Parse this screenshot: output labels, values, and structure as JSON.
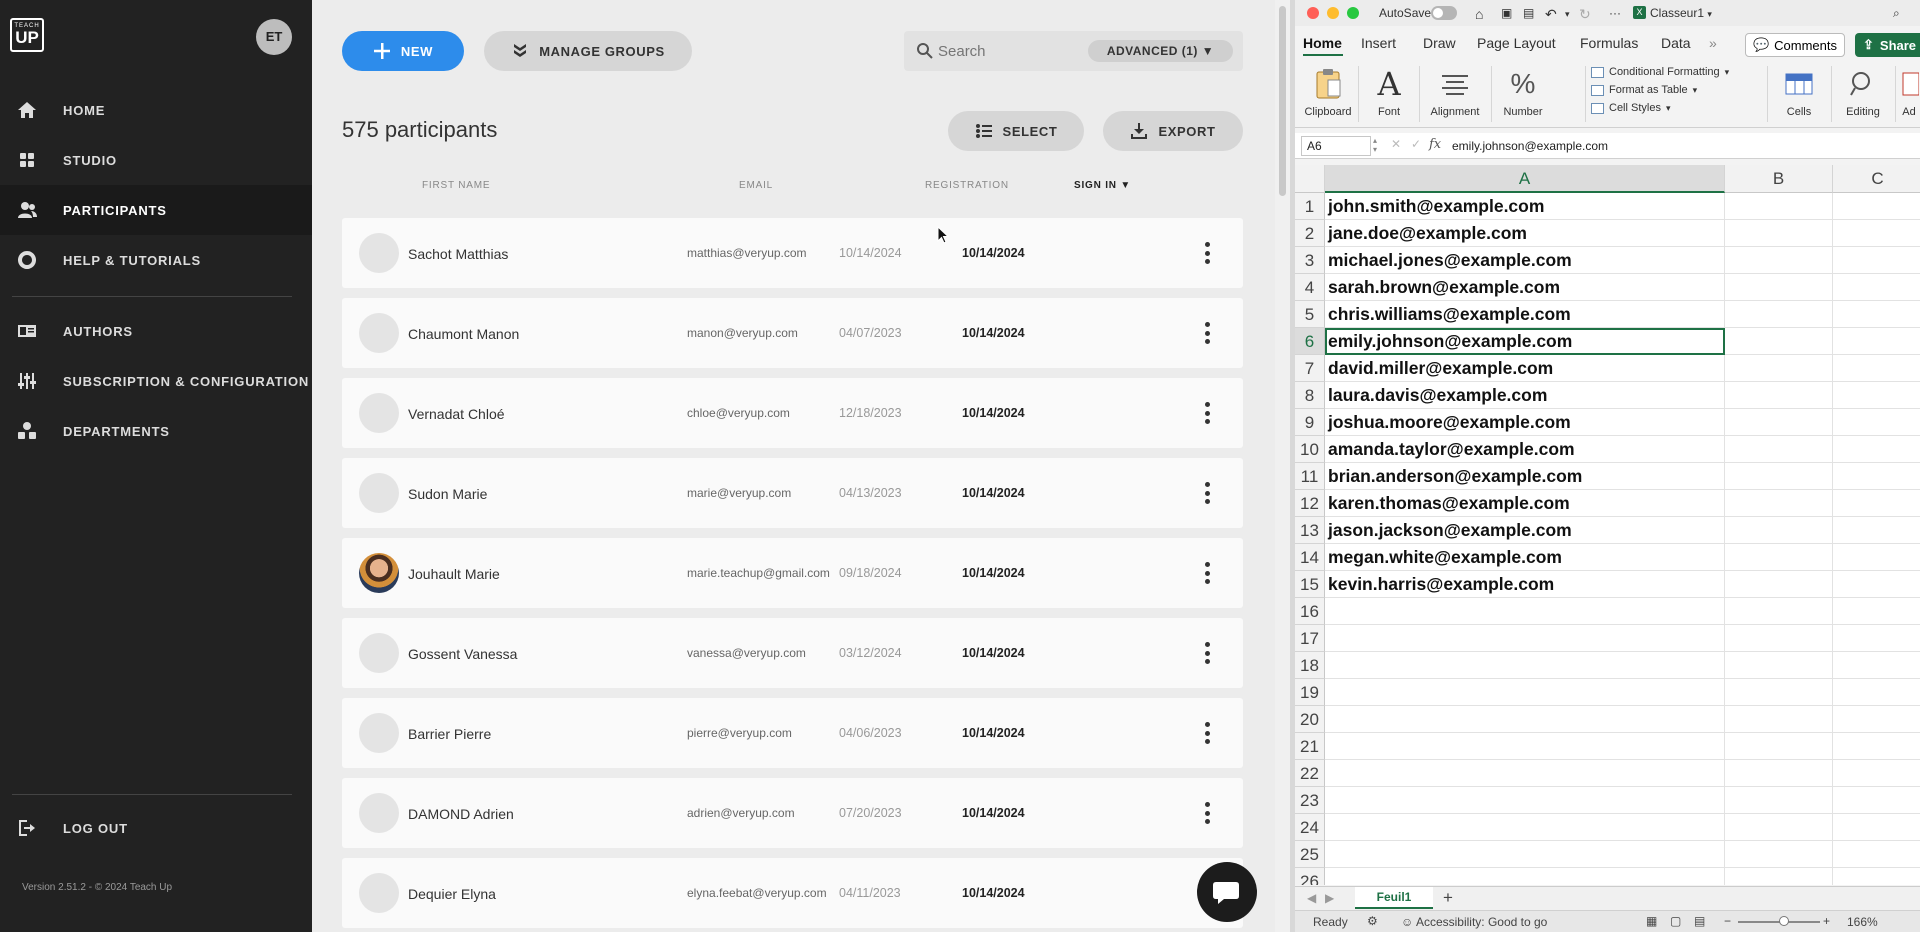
{
  "sidebar": {
    "logo": {
      "line1": "TEACH",
      "line2": "UP"
    },
    "avatar_initials": "ET",
    "items": [
      {
        "label": "HOME",
        "icon": "home-icon"
      },
      {
        "label": "STUDIO",
        "icon": "grid-icon"
      },
      {
        "label": "PARTICIPANTS",
        "icon": "users-icon",
        "active": true
      },
      {
        "label": "HELP & TUTORIALS",
        "icon": "lifebuoy-icon"
      },
      {
        "label": "AUTHORS",
        "icon": "id-card-icon"
      },
      {
        "label": "SUBSCRIPTION & CONFIGURATION",
        "icon": "sliders-icon"
      },
      {
        "label": "DEPARTMENTS",
        "icon": "org-icon"
      }
    ],
    "logout_label": "LOG OUT",
    "version": "Version 2.51.2 - © 2024 Teach Up"
  },
  "toolbar": {
    "new_label": "NEW",
    "manage_groups_label": "MANAGE GROUPS",
    "search_placeholder": "Search",
    "advanced_label": "ADVANCED (1)",
    "select_label": "SELECT",
    "export_label": "EXPORT"
  },
  "participants": {
    "count_label": "575 participants",
    "columns": {
      "first_name": "FIRST NAME",
      "email": "EMAIL",
      "registration": "REGISTRATION",
      "sign_in": "SIGN IN"
    },
    "rows": [
      {
        "name": "Sachot Matthias",
        "email": "matthias@veryup.com",
        "registration": "10/14/2024",
        "sign_in": "10/14/2024",
        "photo": false
      },
      {
        "name": "Chaumont Manon",
        "email": "manon@veryup.com",
        "registration": "04/07/2023",
        "sign_in": "10/14/2024",
        "photo": false
      },
      {
        "name": "Vernadat Chloé",
        "email": "chloe@veryup.com",
        "registration": "12/18/2023",
        "sign_in": "10/14/2024",
        "photo": false
      },
      {
        "name": "Sudon Marie",
        "email": "marie@veryup.com",
        "registration": "04/13/2023",
        "sign_in": "10/14/2024",
        "photo": false
      },
      {
        "name": "Jouhault Marie",
        "email": "marie.teachup@gmail.com",
        "registration": "09/18/2024",
        "sign_in": "10/14/2024",
        "photo": true
      },
      {
        "name": "Gossent Vanessa",
        "email": "vanessa@veryup.com",
        "registration": "03/12/2024",
        "sign_in": "10/14/2024",
        "photo": false
      },
      {
        "name": "Barrier Pierre",
        "email": "pierre@veryup.com",
        "registration": "04/06/2023",
        "sign_in": "10/14/2024",
        "photo": false
      },
      {
        "name": "DAMOND Adrien",
        "email": "adrien@veryup.com",
        "registration": "07/20/2023",
        "sign_in": "10/14/2024",
        "photo": false
      },
      {
        "name": "Dequier Elyna",
        "email": "elyna.feebat@veryup.com",
        "registration": "04/11/2023",
        "sign_in": "10/14/2024",
        "photo": false
      }
    ]
  },
  "excel": {
    "autosave_label": "AutoSave",
    "workbook_name": "Classeur1",
    "tabs": [
      "Home",
      "Insert",
      "Draw",
      "Page Layout",
      "Formulas",
      "Data"
    ],
    "overflow_tabs": "»",
    "comments_label": "Comments",
    "share_label": "Share",
    "ribbon": {
      "clipboard": "Clipboard",
      "font": "Font",
      "alignment": "Alignment",
      "number": "Number",
      "conditional_formatting": "Conditional Formatting",
      "format_as_table": "Format as Table",
      "cell_styles": "Cell Styles",
      "cells": "Cells",
      "editing": "Editing",
      "addins": "Ad"
    },
    "name_box": "A6",
    "fx_label": "fx",
    "formula_value": "emily.johnson@example.com",
    "columns": [
      "A",
      "B",
      "C"
    ],
    "active_row": 6,
    "row_numbers": [
      "1",
      "2",
      "3",
      "4",
      "5",
      "6",
      "7",
      "8",
      "9",
      "10",
      "11",
      "12",
      "13",
      "14",
      "15",
      "16",
      "17",
      "18",
      "19",
      "20",
      "21",
      "22",
      "23",
      "24",
      "25",
      "26"
    ],
    "cells_A": [
      "john.smith@example.com",
      "jane.doe@example.com",
      "michael.jones@example.com",
      "sarah.brown@example.com",
      "chris.williams@example.com",
      "emily.johnson@example.com",
      "david.miller@example.com",
      "laura.davis@example.com",
      "joshua.moore@example.com",
      "amanda.taylor@example.com",
      "brian.anderson@example.com",
      "karen.thomas@example.com",
      "jason.jackson@example.com",
      "megan.white@example.com",
      "kevin.harris@example.com",
      "",
      "",
      "",
      "",
      "",
      "",
      "",
      "",
      "",
      "",
      ""
    ],
    "sheet_tab": "Feuil1",
    "status_ready": "Ready",
    "status_accessibility": "Accessibility: Good to go",
    "zoom": "166%"
  },
  "colors": {
    "accent_blue": "#2d8ceb",
    "excel_green": "#1e7145",
    "sidebar_bg": "#222222"
  }
}
